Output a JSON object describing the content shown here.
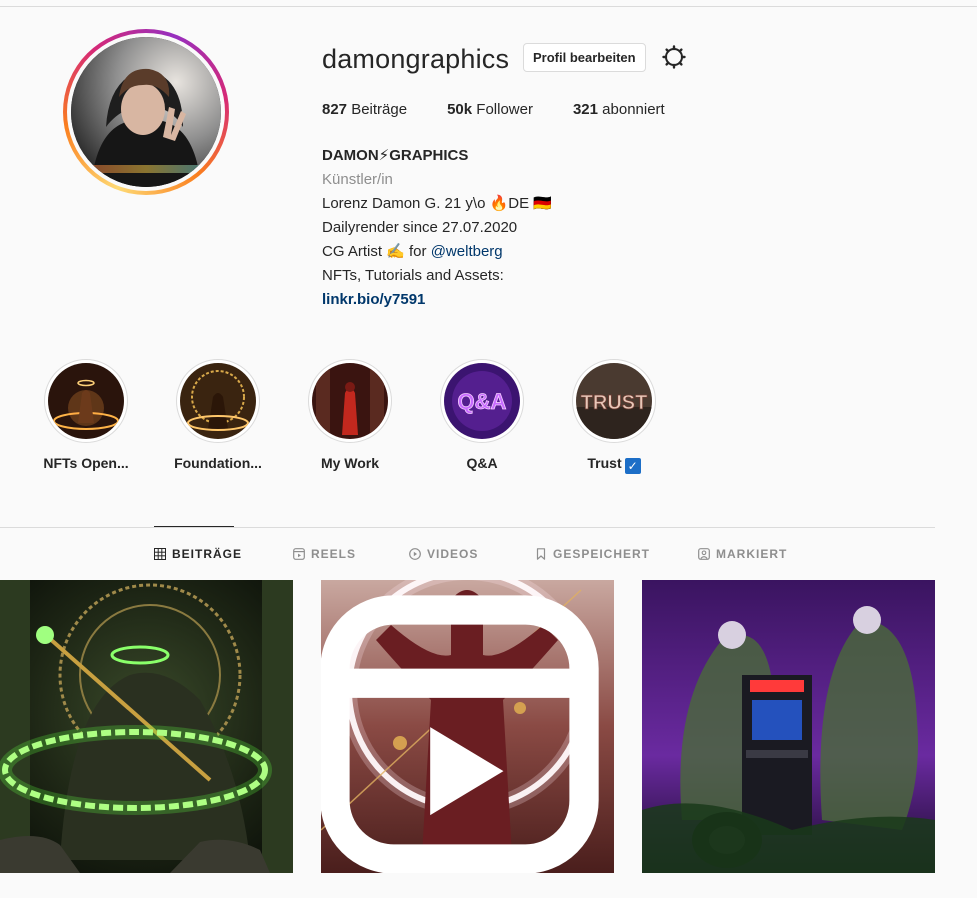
{
  "profile": {
    "username": "damongraphics",
    "edit_label": "Profil bearbeiten",
    "settings_icon": "gear-icon"
  },
  "stats": {
    "posts_count": "827",
    "posts_label": "Beiträge",
    "followers_count": "50k",
    "followers_label": "Follower",
    "following_count": "321",
    "following_label": "abonniert"
  },
  "bio": {
    "display_name": "DAMON⚡GRAPHICS",
    "category": "Künstler/in",
    "line1": "Lorenz Damon G. 21 y\\o 🔥DE 🇩🇪",
    "line2": "Dailyrender since 27.07.2020",
    "line3_prefix": "CG Artist ✍️ for ",
    "line3_mention": "@weltberg",
    "line4": "NFTs, Tutorials and Assets:",
    "link": "linkr.bio/y7591"
  },
  "highlights": [
    {
      "label": "NFTs Open..."
    },
    {
      "label": "Foundation..."
    },
    {
      "label": "My Work"
    },
    {
      "label": "Q&A",
      "image_text": "Q&A"
    },
    {
      "label": "Trust",
      "image_text": "TRUST",
      "badge": "✓"
    }
  ],
  "tabs": [
    {
      "label": "BEITRÄGE",
      "icon": "grid-icon",
      "active": true
    },
    {
      "label": "REELS",
      "icon": "reels-icon",
      "active": false
    },
    {
      "label": "VIDEOS",
      "icon": "play-icon",
      "active": false
    },
    {
      "label": "GESPEICHERT",
      "icon": "bookmark-icon",
      "active": false
    },
    {
      "label": "MARKIERT",
      "icon": "tagged-icon",
      "active": false
    }
  ],
  "colors": {
    "background": "#fafafa",
    "text": "#262626",
    "muted": "#8e8e8e",
    "link": "#00376b",
    "border": "#dbdbdb"
  }
}
